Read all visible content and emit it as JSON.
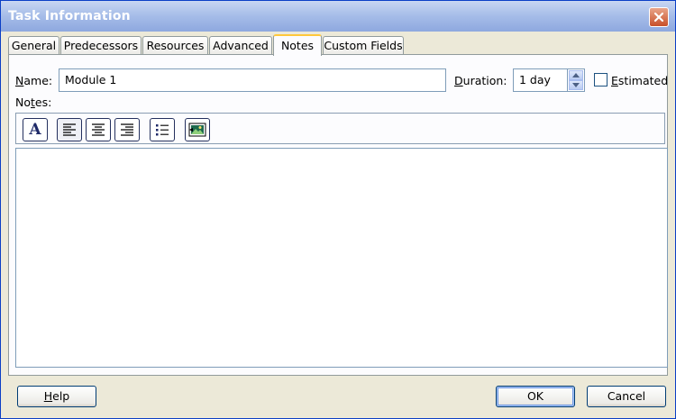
{
  "window": {
    "title": "Task Information"
  },
  "tabs": [
    {
      "label": "General"
    },
    {
      "label": "Predecessors"
    },
    {
      "label": "Resources"
    },
    {
      "label": "Advanced"
    },
    {
      "label": "Notes",
      "active": true
    },
    {
      "label": "Custom Fields"
    }
  ],
  "form": {
    "name_label_first": "N",
    "name_label_rest": "ame:",
    "name_value": "Module 1",
    "duration_label_first": "D",
    "duration_label_rest": "uration:",
    "duration_value": "1 day",
    "estimated_label_first": "E",
    "estimated_label_rest": "stimated",
    "estimated_checked": false,
    "notes_label_first": "No",
    "notes_label_underlined": "t",
    "notes_label_rest": "es:"
  },
  "toolbar": {
    "icons": [
      "font-icon",
      "align-left-icon",
      "align-center-icon",
      "align-right-icon",
      "bullet-list-icon",
      "insert-object-icon"
    ],
    "font_glyph": "A"
  },
  "notes": {
    "text": ""
  },
  "buttons": {
    "help_first": "H",
    "help_rest": "elp",
    "ok": "OK",
    "cancel": "Cancel"
  },
  "colors": {
    "titlebar": "#a5bce8",
    "dialog_bg": "#ece9d8",
    "active_tab_accent": "#ffc83c",
    "close_button": "#c8502a"
  }
}
